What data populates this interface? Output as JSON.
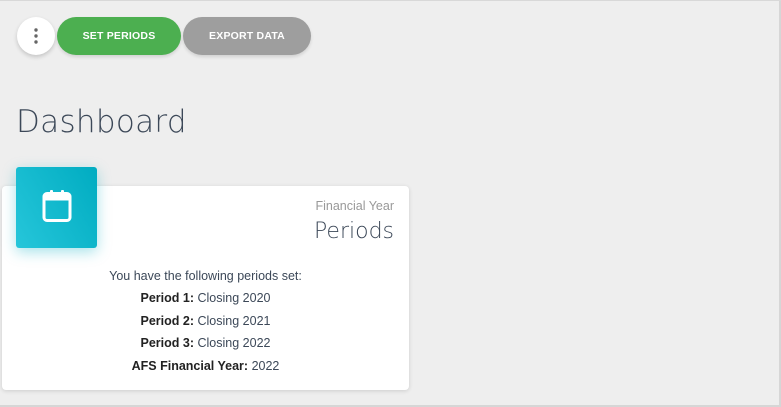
{
  "toolbar": {
    "menu_icon": "more-vert-icon",
    "set_periods_label": "SET PERIODS",
    "export_data_label": "EXPORT DATA",
    "colors": {
      "green": "#4caf50",
      "grey": "#9e9e9e"
    }
  },
  "page": {
    "title": "Dashboard"
  },
  "card": {
    "icon": "calendar-icon",
    "icon_color": "#00acc1",
    "category": "Financial Year",
    "title": "Periods",
    "intro": "You have the following periods set:",
    "rows": [
      {
        "key": "Period 1:",
        "value": "Closing 2020"
      },
      {
        "key": "Period 2:",
        "value": "Closing 2021"
      },
      {
        "key": "Period 3:",
        "value": "Closing 2022"
      },
      {
        "key": "AFS Financial Year:",
        "value": "2022"
      }
    ]
  }
}
